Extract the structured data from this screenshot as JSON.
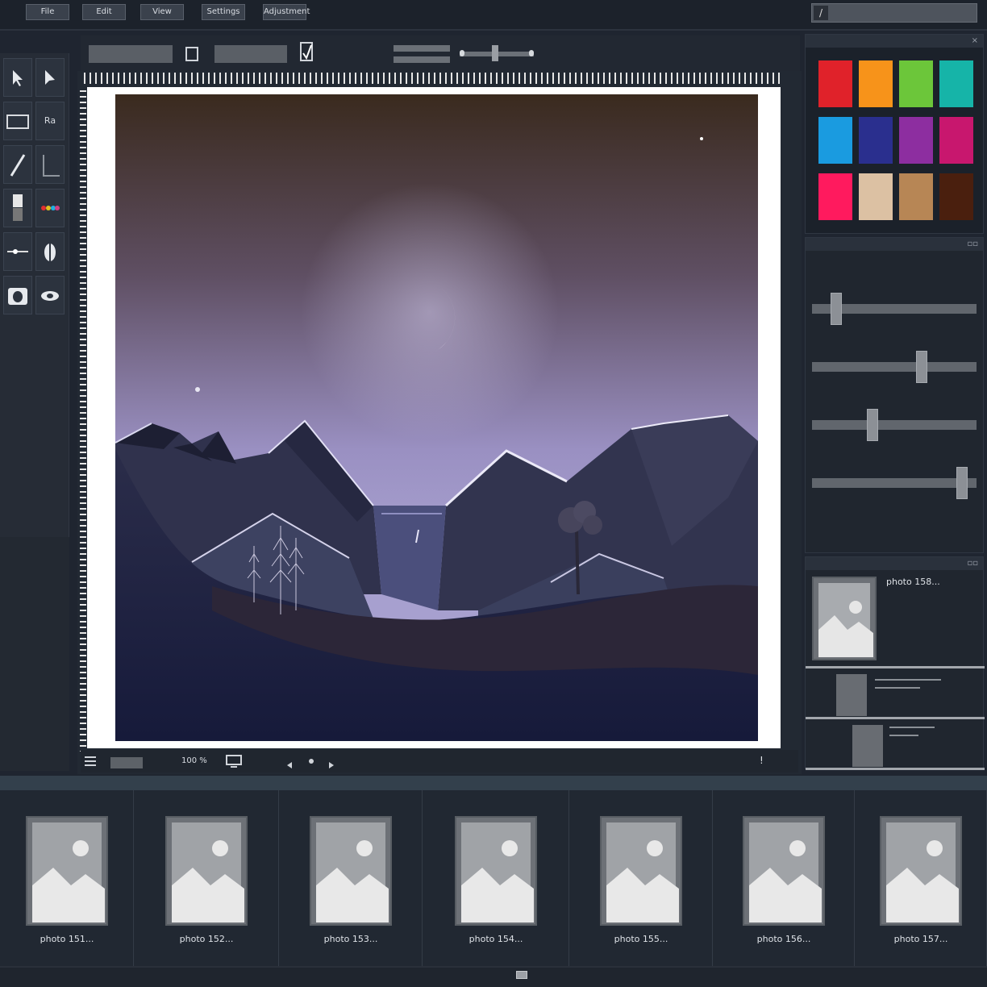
{
  "menu": {
    "items": [
      {
        "label": "File"
      },
      {
        "label": "Edit"
      },
      {
        "label": "View"
      },
      {
        "label": "Settings"
      },
      {
        "label": "Adjustment"
      }
    ]
  },
  "status": {
    "zoom": "100 %",
    "indicator": "!"
  },
  "swatches": [
    "#e0222a",
    "#f7931a",
    "#6cc63a",
    "#16b4a8",
    "#1a9be0",
    "#2a2f8e",
    "#8d2ea0",
    "#c8176e",
    "#ff1a5e",
    "#dcc1a3",
    "#b78655",
    "#4a1f0e"
  ],
  "sliders": [
    0.12,
    0.68,
    0.36,
    0.94
  ],
  "layers": {
    "main_name": "photo 158..."
  },
  "filmstrip": [
    {
      "label": "photo 151..."
    },
    {
      "label": "photo 152..."
    },
    {
      "label": "photo 153..."
    },
    {
      "label": "photo 154..."
    },
    {
      "label": "photo 155..."
    },
    {
      "label": "photo 156..."
    },
    {
      "label": "photo 157..."
    }
  ]
}
